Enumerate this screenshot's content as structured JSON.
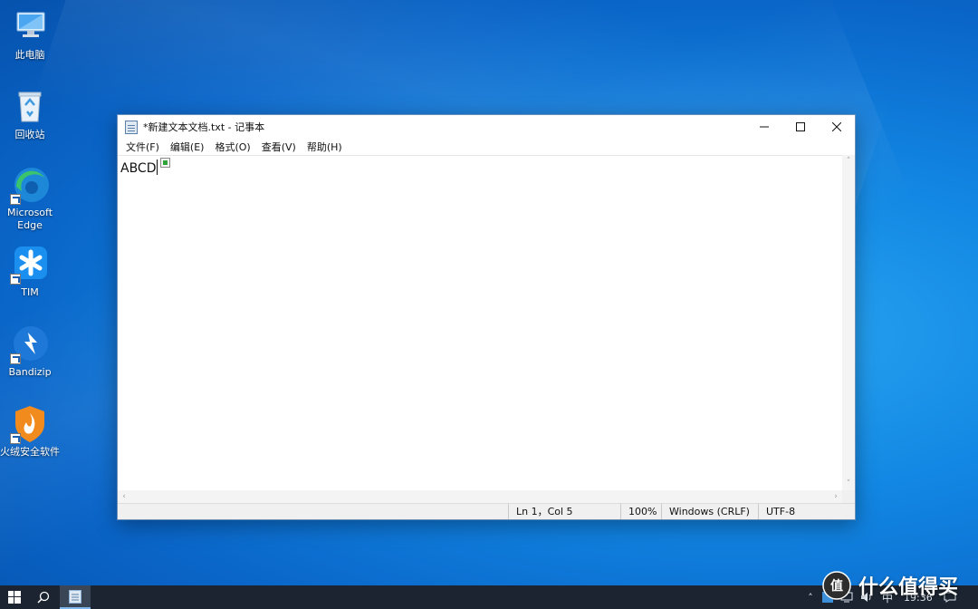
{
  "desktop": {
    "icons": [
      {
        "label": "此电脑",
        "icon": "computer-icon"
      },
      {
        "label": "回收站",
        "icon": "recycle-bin-icon"
      },
      {
        "label": "Microsoft Edge",
        "icon": "edge-icon"
      },
      {
        "label": "TIM",
        "icon": "tim-icon"
      },
      {
        "label": "Bandizip",
        "icon": "bandizip-icon"
      },
      {
        "label": "火绒安全软件",
        "icon": "huorong-icon"
      }
    ]
  },
  "window": {
    "title": "*新建文本文档.txt - 记事本",
    "controls": {
      "minimize": "minimize-icon",
      "maximize": "maximize-icon",
      "close": "close-icon"
    },
    "menu": [
      "文件(F)",
      "编辑(E)",
      "格式(O)",
      "查看(V)",
      "帮助(H)"
    ],
    "content": "ABCD",
    "status": {
      "position": "Ln 1，Col 5",
      "zoom": "100%",
      "line_ending": "Windows (CRLF)",
      "encoding": "UTF-8"
    }
  },
  "taskbar": {
    "time": "19:36",
    "ime": "中",
    "watermark": "什么值得买"
  },
  "colors": {
    "desktop": "#1287e3",
    "taskbar": "#1b2430",
    "edge_blue": "#1e88d8",
    "edge_green": "#3bc46b",
    "tim_blue": "#1a8ff0",
    "bandizip_blue": "#1e78d8",
    "huorong_orange": "#f28b1e"
  }
}
